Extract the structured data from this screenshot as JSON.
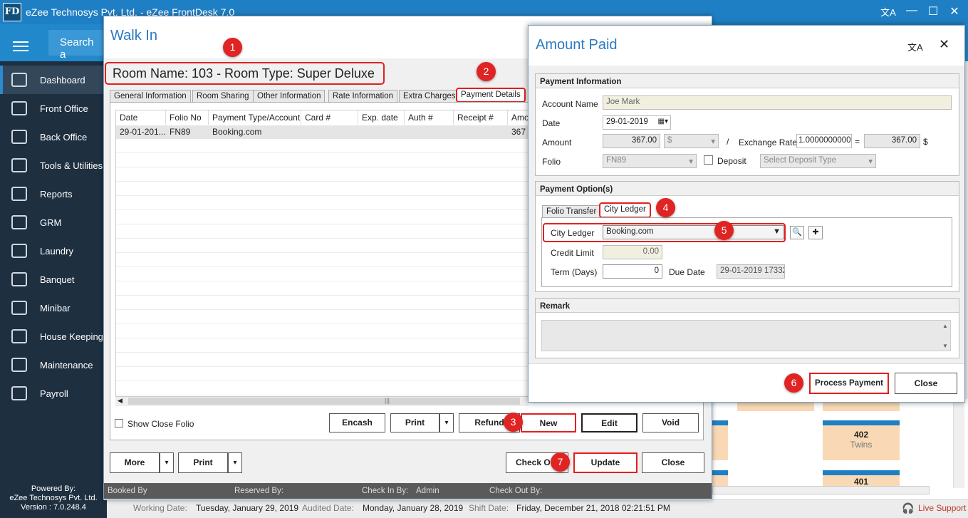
{
  "app": {
    "logo": "FD",
    "title": "eZee Technosys Pvt. Ltd. - eZee FrontDesk 7.0",
    "search_placeholder": "Search a"
  },
  "sidebar": {
    "items": [
      {
        "label": "Dashboard",
        "icon": "dashboard-icon"
      },
      {
        "label": "Front Office",
        "icon": "front-office-icon"
      },
      {
        "label": "Back Office",
        "icon": "back-office-icon"
      },
      {
        "label": "Tools & Utilities",
        "icon": "tools-icon"
      },
      {
        "label": "Reports",
        "icon": "reports-icon"
      },
      {
        "label": "GRM",
        "icon": "grm-icon"
      },
      {
        "label": "Laundry",
        "icon": "laundry-icon"
      },
      {
        "label": "Banquet",
        "icon": "banquet-icon"
      },
      {
        "label": "Minibar",
        "icon": "minibar-icon"
      },
      {
        "label": "House Keeping",
        "icon": "housekeeping-icon"
      },
      {
        "label": "Maintenance",
        "icon": "maintenance-icon"
      },
      {
        "label": "Payroll",
        "icon": "payroll-icon"
      }
    ],
    "powered_by": "Powered By:",
    "company": "eZee Technosys Pvt. Ltd.",
    "version": "Version : 7.0.248.4"
  },
  "statusbar": {
    "working_date_label": "Working Date:",
    "working_date": "Tuesday, January 29, 2019",
    "audited_date_label": "Audited Date:",
    "audited_date": "Monday, January 28, 2019",
    "shift_date_label": "Shift Date:",
    "shift_date": "Friday, December 21, 2018 02:21:51 PM",
    "live_support": "Live Support"
  },
  "dashboard": {
    "tiles": [
      {
        "number": "402",
        "type": "Twins"
      },
      {
        "number": "401",
        "type": ""
      }
    ]
  },
  "walkin": {
    "title": "Walk In",
    "room_header": "Room Name: 103 - Room Type: Super Deluxe",
    "tabs": [
      "General Information",
      "Room Sharing",
      "Other Information",
      "Rate Information",
      "Extra Charges",
      "Payment Details"
    ],
    "grid": {
      "columns": [
        "Date",
        "Folio No",
        "Payment Type/Account",
        "Card #",
        "Exp. date",
        "Auth #",
        "Receipt #",
        "Amo"
      ],
      "rows": [
        [
          "29-01-201...",
          "FN89",
          "Booking.com",
          "",
          "",
          "",
          "",
          "367"
        ]
      ]
    },
    "show_close_folio": "Show Close Folio",
    "buttons": {
      "encash": "Encash",
      "print": "Print",
      "refund": "Refund",
      "new": "New",
      "edit": "Edit",
      "void": "Void",
      "more": "More",
      "print2": "Print",
      "check_out": "Check Out",
      "update": "Update",
      "close": "Close"
    },
    "footer": {
      "booked_by": "Booked By",
      "reserved_by": "Reserved By:",
      "check_in_by_label": "Check In By:",
      "check_in_by": "Admin",
      "check_out_by": "Check Out By:"
    }
  },
  "amount_paid": {
    "title": "Amount Paid",
    "payment_info_header": "Payment Information",
    "account_name_label": "Account Name",
    "account_name": "Joe Mark",
    "date_label": "Date",
    "date": "29-01-2019",
    "amount_label": "Amount",
    "amount": "367.00",
    "currency": "$",
    "slash": "/",
    "exchange_rate_label": "Exchange Rate",
    "exchange_rate": "1.0000000000",
    "equals": "=",
    "converted_amount": "367.00",
    "converted_currency": "$",
    "folio_label": "Folio",
    "folio": "FN89",
    "deposit_label": "Deposit",
    "deposit_type_placeholder": "Select Deposit Type",
    "payment_options_header": "Payment Option(s)",
    "option_tabs": [
      "Folio Transfer",
      "City Ledger"
    ],
    "city_ledger_label": "City Ledger",
    "city_ledger": "Booking.com",
    "credit_limit_label": "Credit Limit",
    "credit_limit": "0.00",
    "term_label": "Term (Days)",
    "term": "0",
    "due_date_label": "Due Date",
    "due_date": "29-01-2019 17332:",
    "remark_header": "Remark",
    "process_payment": "Process Payment",
    "close": "Close"
  },
  "annotations": [
    "1",
    "2",
    "3",
    "4",
    "5",
    "6",
    "7"
  ],
  "colors": {
    "accent_blue": "#1f7fc4",
    "sidebar": "#1e2f40",
    "highlight_red": "#e02020",
    "badge_red": "#e02424",
    "tile_orange": "#f9d9b5"
  }
}
